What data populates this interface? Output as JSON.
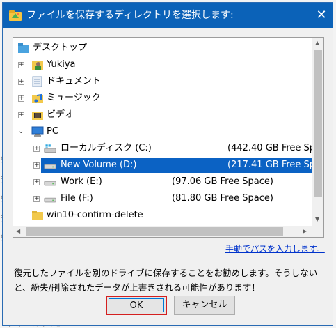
{
  "dialog": {
    "title": "ファイルを保存するディレクトリを選択します:",
    "close_symbol": "✕"
  },
  "tree": {
    "root_label": "デスクトップ",
    "items": [
      {
        "label": "Yukiya",
        "icon": "user-folder-icon"
      },
      {
        "label": "ドキュメント",
        "icon": "documents-icon"
      },
      {
        "label": "ミュージック",
        "icon": "music-icon"
      },
      {
        "label": "ビデオ",
        "icon": "video-icon"
      },
      {
        "label": "PC",
        "icon": "pc-icon"
      },
      {
        "label": "ローカルディスク (C:)",
        "free": "(442.40 GB Free Sp",
        "icon": "windows-drive-icon"
      },
      {
        "label": "New Volume (D:)",
        "free": "(217.41 GB Free Sp",
        "icon": "drive-icon",
        "selected": true
      },
      {
        "label": "Work (E:)",
        "free": "(97.06 GB Free Space)",
        "icon": "drive-icon"
      },
      {
        "label": "File (F:)",
        "free": "(81.80 GB Free Space)",
        "icon": "drive-icon"
      },
      {
        "label": "win10-confirm-delete",
        "icon": "folder-icon"
      }
    ]
  },
  "manual_link": "手動でパスを入力します。",
  "notice": "復元したファイルを別のドライブに保存することをお勧めします。そうしないと、紛失/削除されたデータが上書きされる可能性があります！",
  "buttons": {
    "ok": "OK",
    "cancel": "キャンセル"
  },
  "background": {
    "bottom_text": "ヲ･ﾄ…  ﾉﾉ  ｸﾞｸﾑﾄﾄ      3.6 15 KB"
  },
  "colors": {
    "titlebar": "#0b62b8",
    "selection": "#0b62c4",
    "ok_highlight": "#d41f1f"
  }
}
